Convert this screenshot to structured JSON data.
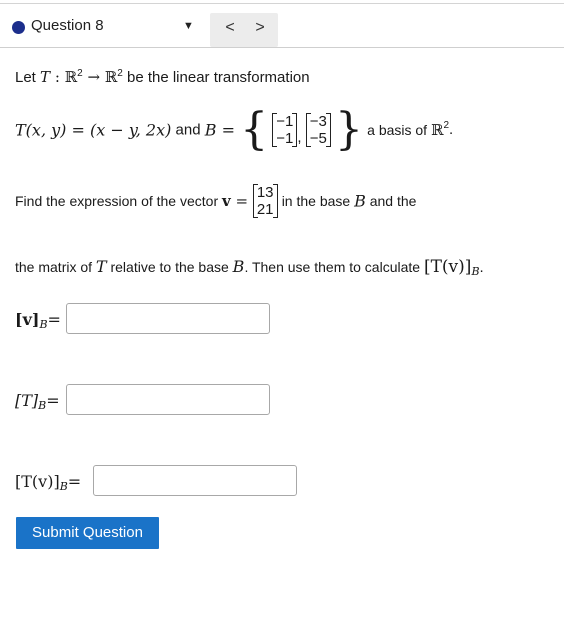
{
  "header": {
    "question_label": "Question 8",
    "dropdown_glyph": "▼",
    "prev_glyph": "<",
    "next_glyph": ">"
  },
  "problem": {
    "line1_let": "Let",
    "line1_T": "T",
    "line1_colon": " : ",
    "line1_R2a": "ℝ",
    "line1_arrow": " → ",
    "line1_R2b": "ℝ",
    "line1_sup": "2",
    "line1_rest": " be the linear transformation",
    "line2_def": "T(x, y) = (x − y, 2x)",
    "line2_and": " and ",
    "line2_B": "B = ",
    "brace_open": "{",
    "brace_close": "}",
    "basis1_top": "−1",
    "basis1_bottom": "−1",
    "basis2_top": "−3",
    "basis2_bottom": "−5",
    "comma": ",",
    "line2_tail": " a basis of ",
    "line2_R2": "ℝ",
    "line2_period": ".",
    "line3_text": "Find the expression of the vector ",
    "line3_v": "v",
    "line3_eq": " = ",
    "v_top": "13",
    "v_bottom": "21",
    "line3_tail": " in the base ",
    "line3_B": "B",
    "line3_and": " and the",
    "line4_text": "the matrix of ",
    "line4_T": "T",
    "line4_mid": " relative to the base ",
    "line4_B": "B",
    "line4_rest": ". Then use them to calculate ",
    "line4_Tv": "[T(v)]",
    "line4_sub": "B",
    "line4_period": "."
  },
  "answers": {
    "vB_label": "[v]",
    "vB_sub": "B",
    "vB_eq": "=",
    "vB_value": "",
    "TB_label": "[T]",
    "TB_sub": "B",
    "TB_eq": "=",
    "TB_value": "",
    "TvB_label": "[T(v)]",
    "TvB_sub": "B",
    "TvB_eq": "=",
    "TvB_value": ""
  },
  "submit_label": "Submit Question",
  "colors": {
    "dot": "#1c2e8c",
    "submit_bg": "#1a73c8",
    "nav_bg": "#ececec"
  }
}
